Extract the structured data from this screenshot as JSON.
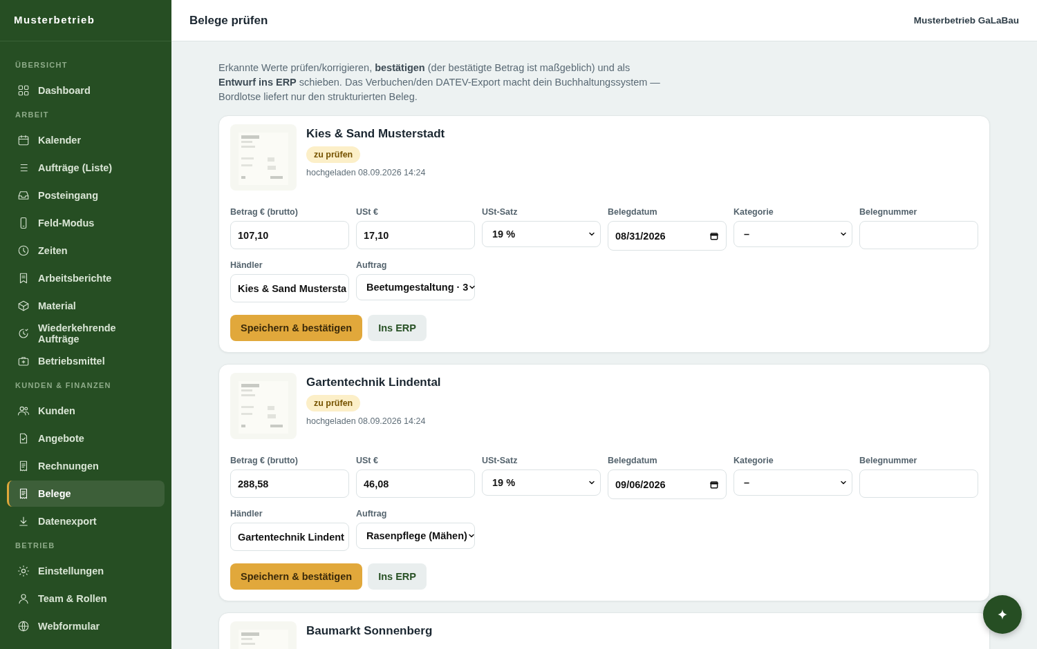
{
  "brand": "Musterbetrieb",
  "sidebar": {
    "sections": [
      {
        "label": "ÜBERSICHT",
        "items": [
          {
            "label": "Dashboard",
            "selected": false
          }
        ]
      },
      {
        "label": "ARBEIT",
        "items": [
          {
            "label": "Kalender",
            "selected": false
          },
          {
            "label": "Aufträge (Liste)",
            "selected": false
          },
          {
            "label": "Posteingang",
            "selected": false
          },
          {
            "label": "Feld-Modus",
            "selected": false
          },
          {
            "label": "Zeiten",
            "selected": false
          },
          {
            "label": "Arbeitsberichte",
            "selected": false
          },
          {
            "label": "Material",
            "selected": false
          },
          {
            "label": "Wiederkehrende Aufträge",
            "selected": false
          },
          {
            "label": "Betriebsmittel",
            "selected": false
          }
        ]
      },
      {
        "label": "KUNDEN & FINANZEN",
        "items": [
          {
            "label": "Kunden",
            "selected": false
          },
          {
            "label": "Angebote",
            "selected": false
          },
          {
            "label": "Rechnungen",
            "selected": false
          },
          {
            "label": "Belege",
            "selected": true
          },
          {
            "label": "Datenexport",
            "selected": false
          }
        ]
      },
      {
        "label": "BETRIEB",
        "items": [
          {
            "label": "Einstellungen",
            "selected": false
          },
          {
            "label": "Team & Rollen",
            "selected": false
          },
          {
            "label": "Webformular",
            "selected": false
          }
        ]
      }
    ]
  },
  "header": {
    "title": "Belege prüfen",
    "company": "Musterbetrieb GaLaBau"
  },
  "intro": "Erkannte Werte prüfen/korrigieren, **bestätigen** (der bestätigte Betrag ist maßgeblich) und als **Entwurf ins ERP** schieben. Das Verbuchen/den DATEV-Export macht dein Buchhaltungssystem — Bordlotse liefert nur den strukturierten Beleg.",
  "receipts": [
    {
      "merchant": "Kies & Sand Musterstadt",
      "status": "zu prüfen",
      "uploaded": "hochgeladen 08.09.2026 14:24",
      "fields": [
        {
          "kind": "text",
          "label": "Betrag € (brutto)",
          "value": "107,10"
        },
        {
          "kind": "text",
          "label": "USt €",
          "value": "17,10"
        },
        {
          "kind": "select",
          "label": "USt-Satz",
          "value": "19 %"
        },
        {
          "kind": "date",
          "label": "Belegdatum",
          "value": "08/31/2026"
        },
        {
          "kind": "select",
          "label": "Kategorie",
          "value": "–"
        },
        {
          "kind": "text",
          "label": "Belegnummer"
        },
        {
          "kind": "text",
          "label": "Händler",
          "value": "Kies & Sand Mustersta"
        },
        {
          "kind": "select",
          "label": "Auftrag",
          "value": "Beetumgestaltung · 3"
        }
      ],
      "buttons": [
        {
          "kind": "primary",
          "label": "Speichern & bestätigen"
        },
        {
          "kind": "secondary",
          "label": "Ins ERP"
        }
      ]
    },
    {
      "merchant": "Gartentechnik Lindental",
      "status": "zu prüfen",
      "uploaded": "hochgeladen 08.09.2026 14:24",
      "fields": [
        {
          "kind": "text",
          "label": "Betrag € (brutto)",
          "value": "288,58"
        },
        {
          "kind": "text",
          "label": "USt €",
          "value": "46,08"
        },
        {
          "kind": "select",
          "label": "USt-Satz",
          "value": "19 %"
        },
        {
          "kind": "date",
          "label": "Belegdatum",
          "value": "09/06/2026"
        },
        {
          "kind": "select",
          "label": "Kategorie",
          "value": "–"
        },
        {
          "kind": "text",
          "label": "Belegnummer"
        },
        {
          "kind": "text",
          "label": "Händler",
          "value": "Gartentechnik Lindent"
        },
        {
          "kind": "select",
          "label": "Auftrag",
          "value": "Rasenpflege (Mähen)"
        }
      ],
      "buttons": [
        {
          "kind": "primary",
          "label": "Speichern & bestätigen"
        },
        {
          "kind": "secondary",
          "label": "Ins ERP"
        }
      ]
    },
    {
      "merchant": "Baumarkt Sonnenberg"
    }
  ]
}
